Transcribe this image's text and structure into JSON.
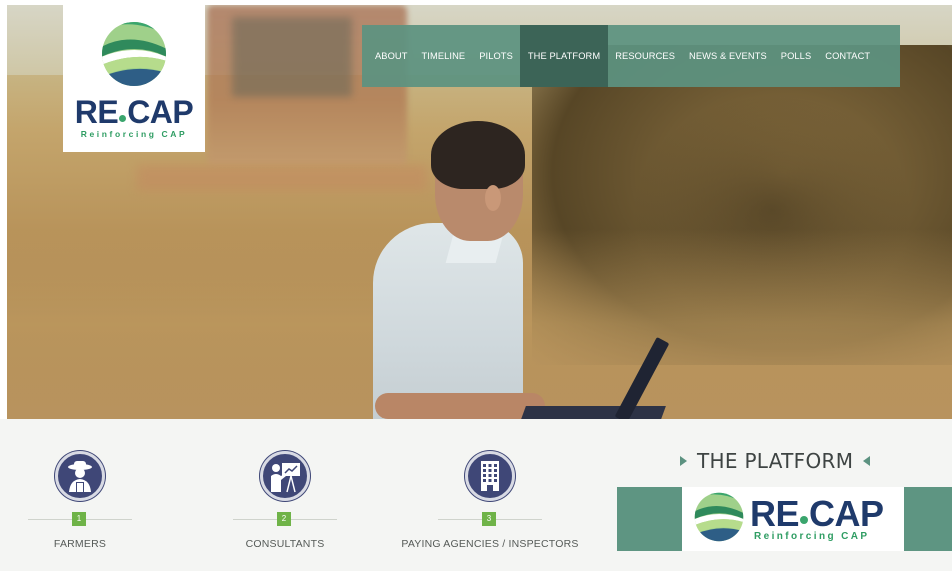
{
  "logo": {
    "name_left": "RE",
    "name_right": "CAP",
    "tagline": "Reinforcing CAP"
  },
  "nav": {
    "items": [
      {
        "label": "ABOUT"
      },
      {
        "label": "TIMELINE"
      },
      {
        "label": "PILOTS"
      },
      {
        "label": "THE PLATFORM",
        "active": true
      },
      {
        "label": "RESOURCES"
      },
      {
        "label": "NEWS & EVENTS"
      },
      {
        "label": "POLLS"
      },
      {
        "label": "CONTACT"
      }
    ]
  },
  "users": [
    {
      "step": "1",
      "label": "FARMERS",
      "icon": "farmer-icon"
    },
    {
      "step": "2",
      "label": "CONSULTANTS",
      "icon": "consultant-presentation-icon"
    },
    {
      "step": "3",
      "label": "PAYING AGENCIES / INSPECTORS",
      "icon": "building-icon"
    }
  ],
  "platform": {
    "title": "THE PLATFORM",
    "logo_left": "RE",
    "logo_right": "CAP",
    "logo_tagline": "Reinforcing CAP"
  },
  "colors": {
    "nav_bg": "#5c9280",
    "nav_active": "#3c6457",
    "brand_blue": "#1f3a6b",
    "brand_green": "#3aa56d",
    "step_green": "#6fb348",
    "icon_navy": "#3f4777"
  }
}
